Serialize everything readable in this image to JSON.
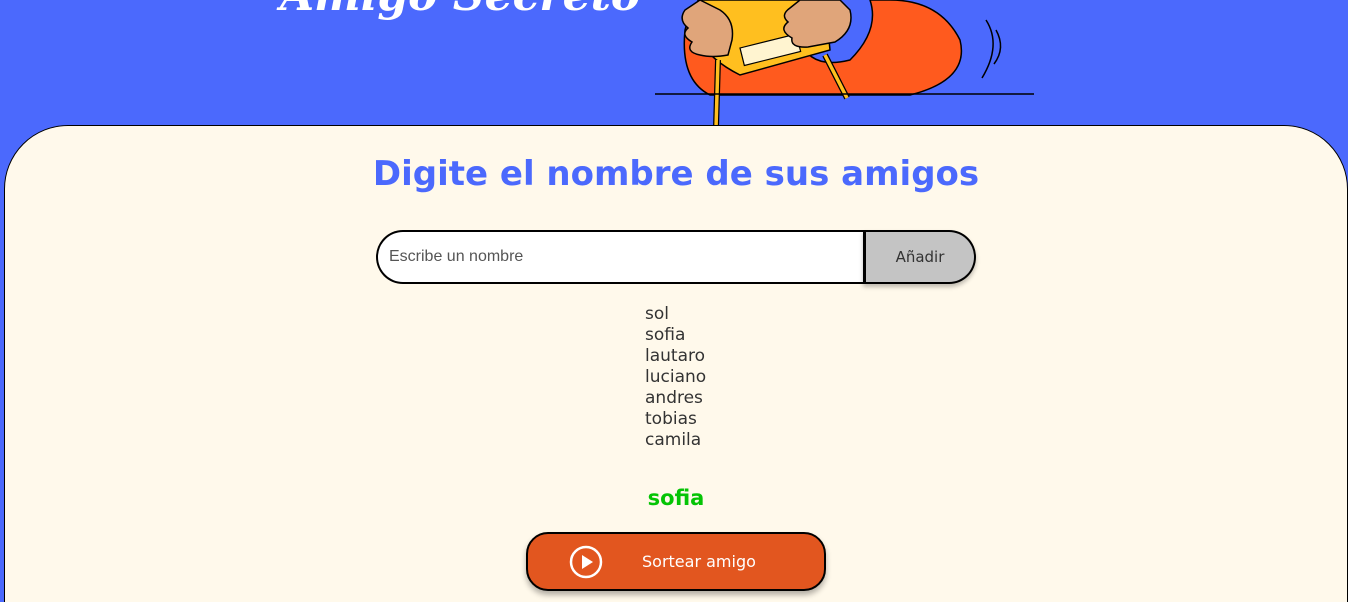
{
  "header": {
    "title": "Amigo Secreto"
  },
  "main": {
    "heading": "Digite el nombre de sus amigos",
    "input": {
      "placeholder": "Escribe un nombre",
      "value": ""
    },
    "add_button_label": "Añadir",
    "friends": [
      "sol",
      "sofia",
      "lautaro",
      "luciano",
      "andres",
      "tobias",
      "camila"
    ],
    "result": "sofia",
    "draw_button_label": "Sortear amigo",
    "draw_button_icon": "play-circle-icon"
  },
  "colors": {
    "background": "#4b69fd",
    "panel": "#fff9eb",
    "heading": "#4b69fd",
    "result": "#05c405",
    "draw_button": "#e2561f",
    "add_button": "#c4c4c4"
  }
}
